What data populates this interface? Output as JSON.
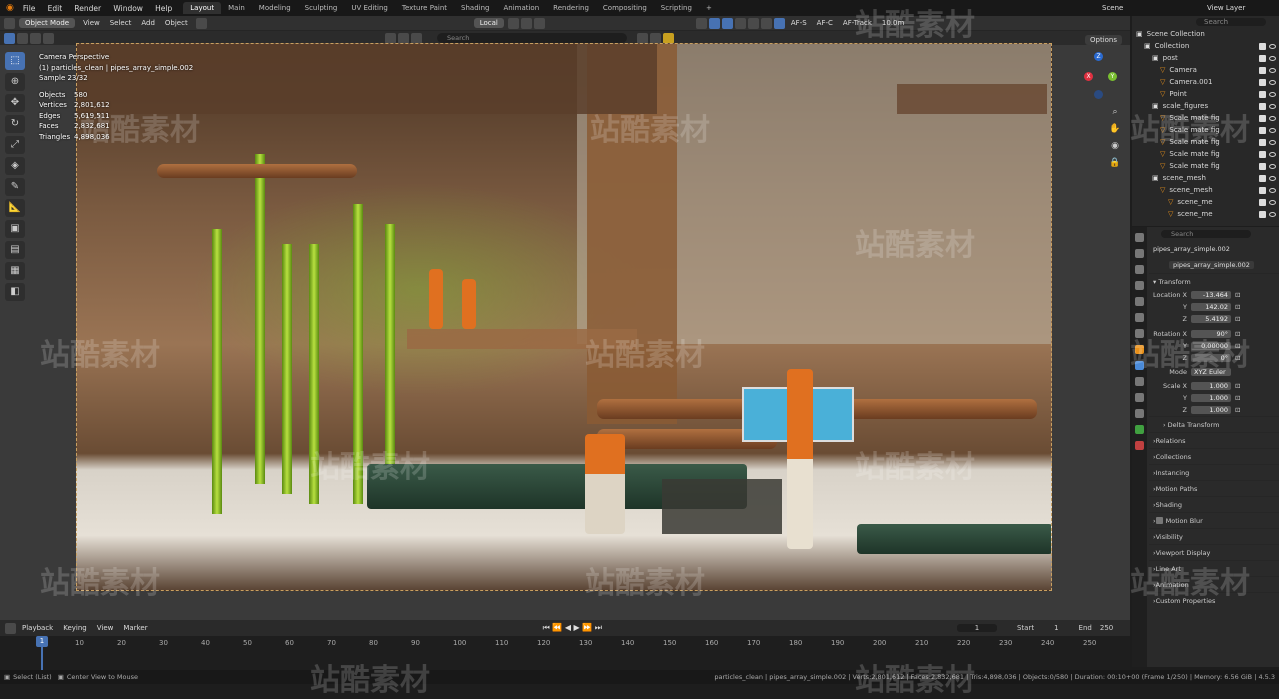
{
  "topbar": {
    "menus": [
      "File",
      "Edit",
      "Render",
      "Window",
      "Help"
    ],
    "tabs": [
      "Layout",
      "Main",
      "Modeling",
      "Sculpting",
      "UV Editing",
      "Texture Paint",
      "Shading",
      "Animation",
      "Rendering",
      "Compositing",
      "Scripting"
    ],
    "scene_label": "Scene",
    "view_layer_label": "View Layer"
  },
  "header": {
    "mode": "Object Mode",
    "menus": [
      "View",
      "Select",
      "Add",
      "Object"
    ],
    "transform_orientation": "Local",
    "af_s": "AF-S",
    "af_c": "AF-C",
    "af_track": "AF-Track",
    "distance": "10.0m"
  },
  "toolbar2": {
    "search_placeholder": "Search"
  },
  "viewport": {
    "options_label": "Options",
    "overlay_title": "Camera Perspective",
    "overlay_collection": "(1) particles_clean | pipes_array_simple.002",
    "overlay_sample": "Sample 23/32",
    "stats": [
      {
        "label": "Objects",
        "value": "580"
      },
      {
        "label": "Vertices",
        "value": "2,801,612"
      },
      {
        "label": "Edges",
        "value": "5,619,511"
      },
      {
        "label": "Faces",
        "value": "2,832,681"
      },
      {
        "label": "Triangles",
        "value": "4,898,036"
      }
    ],
    "gizmo": {
      "x": "X",
      "y": "Y",
      "z": "Z"
    }
  },
  "outliner": {
    "search_placeholder": "Search",
    "rows": [
      {
        "label": "Scene Collection",
        "indent": 0
      },
      {
        "label": "Collection",
        "indent": 1
      },
      {
        "label": "post",
        "indent": 2
      },
      {
        "label": "Camera",
        "indent": 3
      },
      {
        "label": "Camera.001",
        "indent": 3
      },
      {
        "label": "Point",
        "indent": 3
      },
      {
        "label": "scale_figures",
        "indent": 2
      },
      {
        "label": "Scale mate fig",
        "indent": 3
      },
      {
        "label": "Scale mate fig",
        "indent": 3
      },
      {
        "label": "Scale mate fig",
        "indent": 3
      },
      {
        "label": "Scale mate fig",
        "indent": 3
      },
      {
        "label": "Scale mate fig",
        "indent": 3
      },
      {
        "label": "scene_mesh",
        "indent": 2
      },
      {
        "label": "scene_mesh",
        "indent": 3
      },
      {
        "label": "scene_me",
        "indent": 4
      },
      {
        "label": "scene_me",
        "indent": 4
      }
    ]
  },
  "properties": {
    "search_placeholder": "Search",
    "object_name": "pipes_array_simple.002",
    "data_name": "pipes_array_simple.002",
    "transform_label": "Transform",
    "location": [
      {
        "axis": "Location X",
        "value": "-13.464"
      },
      {
        "axis": "Y",
        "value": "142.02"
      },
      {
        "axis": "Z",
        "value": "5.4192"
      }
    ],
    "rotation": [
      {
        "axis": "Rotation X",
        "value": "90°"
      },
      {
        "axis": "Y",
        "value": "0.00000"
      },
      {
        "axis": "Z",
        "value": "0°"
      }
    ],
    "mode_label": "Mode",
    "mode_value": "XYZ Euler",
    "scale": [
      {
        "axis": "Scale X",
        "value": "1.000"
      },
      {
        "axis": "Y",
        "value": "1.000"
      },
      {
        "axis": "Z",
        "value": "1.000"
      }
    ],
    "delta_label": "Delta Transform",
    "sections": [
      "Relations",
      "Collections",
      "Instancing",
      "Motion Paths",
      "Shading",
      "Motion Blur",
      "Visibility",
      "Viewport Display",
      "Line Art",
      "Animation",
      "Custom Properties"
    ]
  },
  "timeline": {
    "menus": [
      "Playback",
      "Keying",
      "View",
      "Marker"
    ],
    "current_frame": "1",
    "start_label": "Start",
    "start_value": "1",
    "end_label": "End",
    "end_value": "250",
    "ticks": [
      "10",
      "20",
      "30",
      "40",
      "50",
      "60",
      "70",
      "80",
      "90",
      "100",
      "110",
      "120",
      "130",
      "140",
      "150",
      "160",
      "170",
      "180",
      "190",
      "200",
      "210",
      "220",
      "230",
      "240",
      "250"
    ],
    "playhead": "1"
  },
  "statusbar": {
    "left1": "Select (List)",
    "left2": "Center View to Mouse",
    "right": "particles_clean | pipes_array_simple.002 | Verts:2,801,612 | Faces:2,832,681 | Tris:4,898,036 | Objects:0/580 | Duration: 00:10+00 (Frame 1/250) | Memory: 6.56 GiB | 4.5.3"
  },
  "watermark": "站酷素材"
}
